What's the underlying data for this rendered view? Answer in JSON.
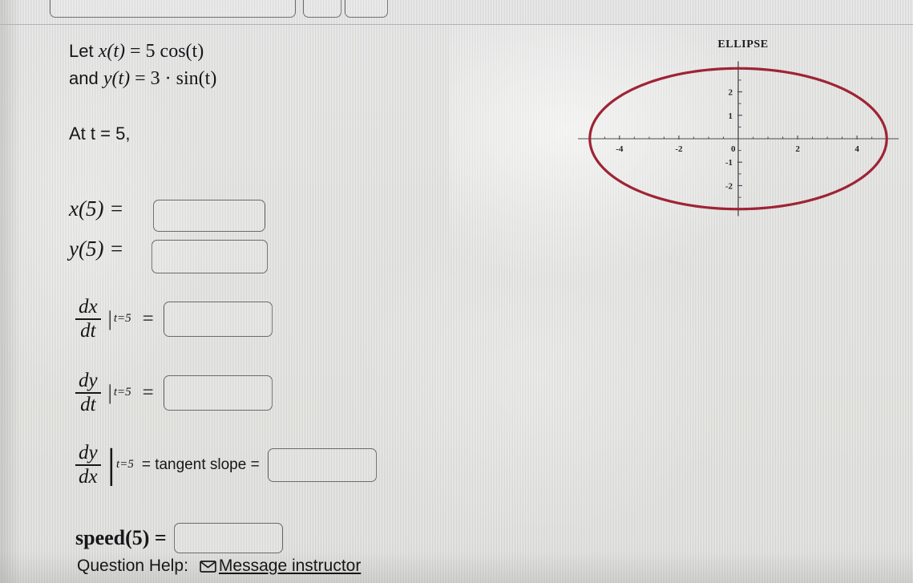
{
  "page": {
    "background_color": "#dcdcd8",
    "text_color": "#17171a"
  },
  "top_widgets": {
    "box_1": "",
    "box_2": "",
    "box_3": ""
  },
  "problem": {
    "line1_prefix": "Let ",
    "line1_func": "x(t)",
    "line1_eq": " = 5 cos(t)",
    "line2_prefix": "and ",
    "line2_func": "y(t)",
    "line2_eq": " = 3 · sin(t)",
    "at_t_text": "At t = 5,"
  },
  "answers": {
    "x5_label": "x(5) =",
    "x5_value": "",
    "x5_placeholder": "",
    "y5_label": "y(5) =",
    "y5_value": "",
    "y5_placeholder": "",
    "dxdt_num": "dx",
    "dxdt_den": "dt",
    "dxdt_eval": "t=5",
    "dxdt_equals": "=",
    "dxdt_value": "",
    "dydt_num": "dy",
    "dydt_den": "dt",
    "dydt_eval": "t=5",
    "dydt_equals": "=",
    "dydt_value": "",
    "dydx_num": "dy",
    "dydx_den": "dx",
    "dydx_eval": "t=5",
    "dydx_text": "= tangent slope =",
    "dydx_value": "",
    "speed_label": "speed(5) =",
    "speed_value": ""
  },
  "help": {
    "label": "Question Help:",
    "icon": "envelope-icon",
    "link_text": "Message instructor"
  },
  "chart_data": {
    "type": "line",
    "title": "ELLIPSE",
    "xlabel": "",
    "ylabel": "",
    "curve": "parametric ellipse x(t) = 5 cos(t), y(t) = 3 sin(t)",
    "semi_axis_x": 5,
    "semi_axis_y": 3,
    "curve_color": "#9e2434",
    "axis_color": "#4c4c52",
    "grid": false,
    "legend": null,
    "xlim": [
      -5.4,
      5.4
    ],
    "ylim": [
      -3.3,
      3.3
    ],
    "x_ticks": [
      -4,
      -2,
      0,
      2,
      4
    ],
    "x_tick_labels": [
      "-4",
      "-2",
      "0",
      "2",
      "4"
    ],
    "x_minor_ticks": [
      -5,
      -4.5,
      -3.5,
      -3,
      -2.5,
      -1.5,
      -1,
      -0.5,
      0.5,
      1,
      1.5,
      2.5,
      3,
      3.5,
      4.5,
      5
    ],
    "y_ticks": [
      -2,
      -1,
      0,
      1,
      2
    ],
    "y_tick_labels": [
      "-2",
      "-1",
      "0",
      "1",
      "2"
    ],
    "y_minor_ticks": [
      -3,
      -2.5,
      -1.5,
      -0.5,
      0.5,
      1.5,
      2.5,
      3
    ]
  }
}
